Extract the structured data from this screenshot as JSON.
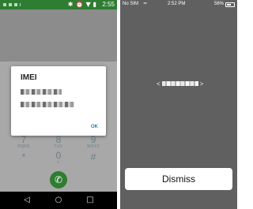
{
  "android": {
    "status_bar": {
      "icons": [
        "bluetooth-icon",
        "alarm-icon",
        "signal-icon",
        "battery-icon"
      ],
      "time": "2:55",
      "color": "#2e7d32"
    },
    "dialog": {
      "title": "IMEI",
      "ok_label": "OK"
    },
    "dialpad": {
      "keys": [
        {
          "digit": "7",
          "letters": "PQRS"
        },
        {
          "digit": "8",
          "letters": "TUV"
        },
        {
          "digit": "9",
          "letters": "WXYZ"
        },
        {
          "digit": "*",
          "letters": ""
        },
        {
          "digit": "0",
          "letters": "+"
        },
        {
          "digit": "#",
          "letters": ""
        }
      ]
    },
    "call_icon": "phone-icon",
    "nav": {
      "back": "◁",
      "home": "○",
      "recents": "□"
    }
  },
  "ios": {
    "status_bar": {
      "carrier": "No SIM",
      "wifi": "wifi-icon",
      "time": "2:52 PM",
      "battery": "56%"
    },
    "code": {
      "open": "<",
      "close": ">"
    },
    "dismiss_label": "Dismiss"
  }
}
